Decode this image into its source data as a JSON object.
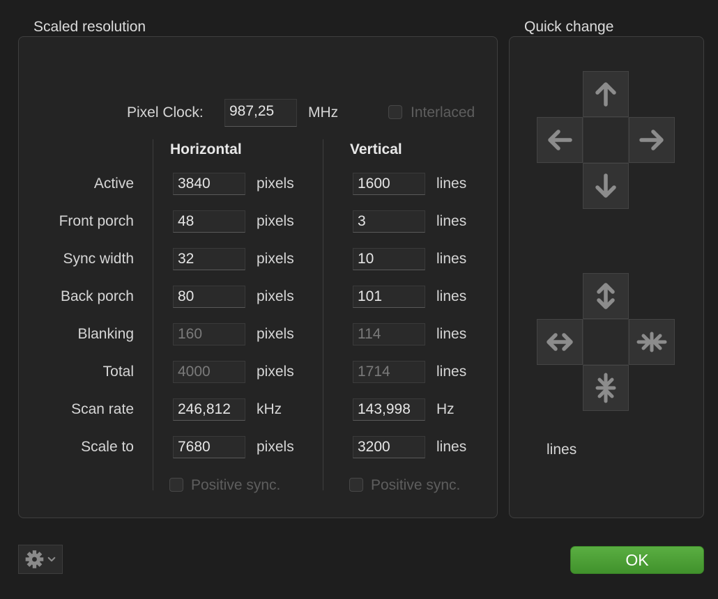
{
  "scaled_resolution": {
    "title": "Scaled resolution",
    "pixel_clock_label": "Pixel Clock:",
    "pixel_clock_value": "987,25",
    "pixel_clock_unit": "MHz",
    "interlaced_label": "Interlaced",
    "horizontal_header": "Horizontal",
    "vertical_header": "Vertical",
    "rows": [
      {
        "label": "Active",
        "h": "3840",
        "h_unit": "pixels",
        "v": "1600",
        "v_unit": "lines"
      },
      {
        "label": "Front porch",
        "h": "48",
        "h_unit": "pixels",
        "v": "3",
        "v_unit": "lines"
      },
      {
        "label": "Sync width",
        "h": "32",
        "h_unit": "pixels",
        "v": "10",
        "v_unit": "lines"
      },
      {
        "label": "Back porch",
        "h": "80",
        "h_unit": "pixels",
        "v": "101",
        "v_unit": "lines"
      },
      {
        "label": "Blanking",
        "h": "160",
        "h_unit": "pixels",
        "v": "114",
        "v_unit": "lines"
      },
      {
        "label": "Total",
        "h": "4000",
        "h_unit": "pixels",
        "v": "1714",
        "v_unit": "lines"
      },
      {
        "label": "Scan rate",
        "h": "246,812",
        "h_unit": "kHz",
        "v": "143,998",
        "v_unit": "Hz"
      },
      {
        "label": "Scale to",
        "h": "7680",
        "h_unit": "pixels",
        "v": "3200",
        "v_unit": "lines"
      }
    ],
    "h_positive_sync": "Positive sync.",
    "v_positive_sync": "Positive sync."
  },
  "quick_change": {
    "title": "Quick change",
    "unit_label": "lines"
  },
  "footer": {
    "ok_label": "OK"
  },
  "colors": {
    "ok_button": "#4fa23a",
    "background": "#1e1e1e"
  }
}
